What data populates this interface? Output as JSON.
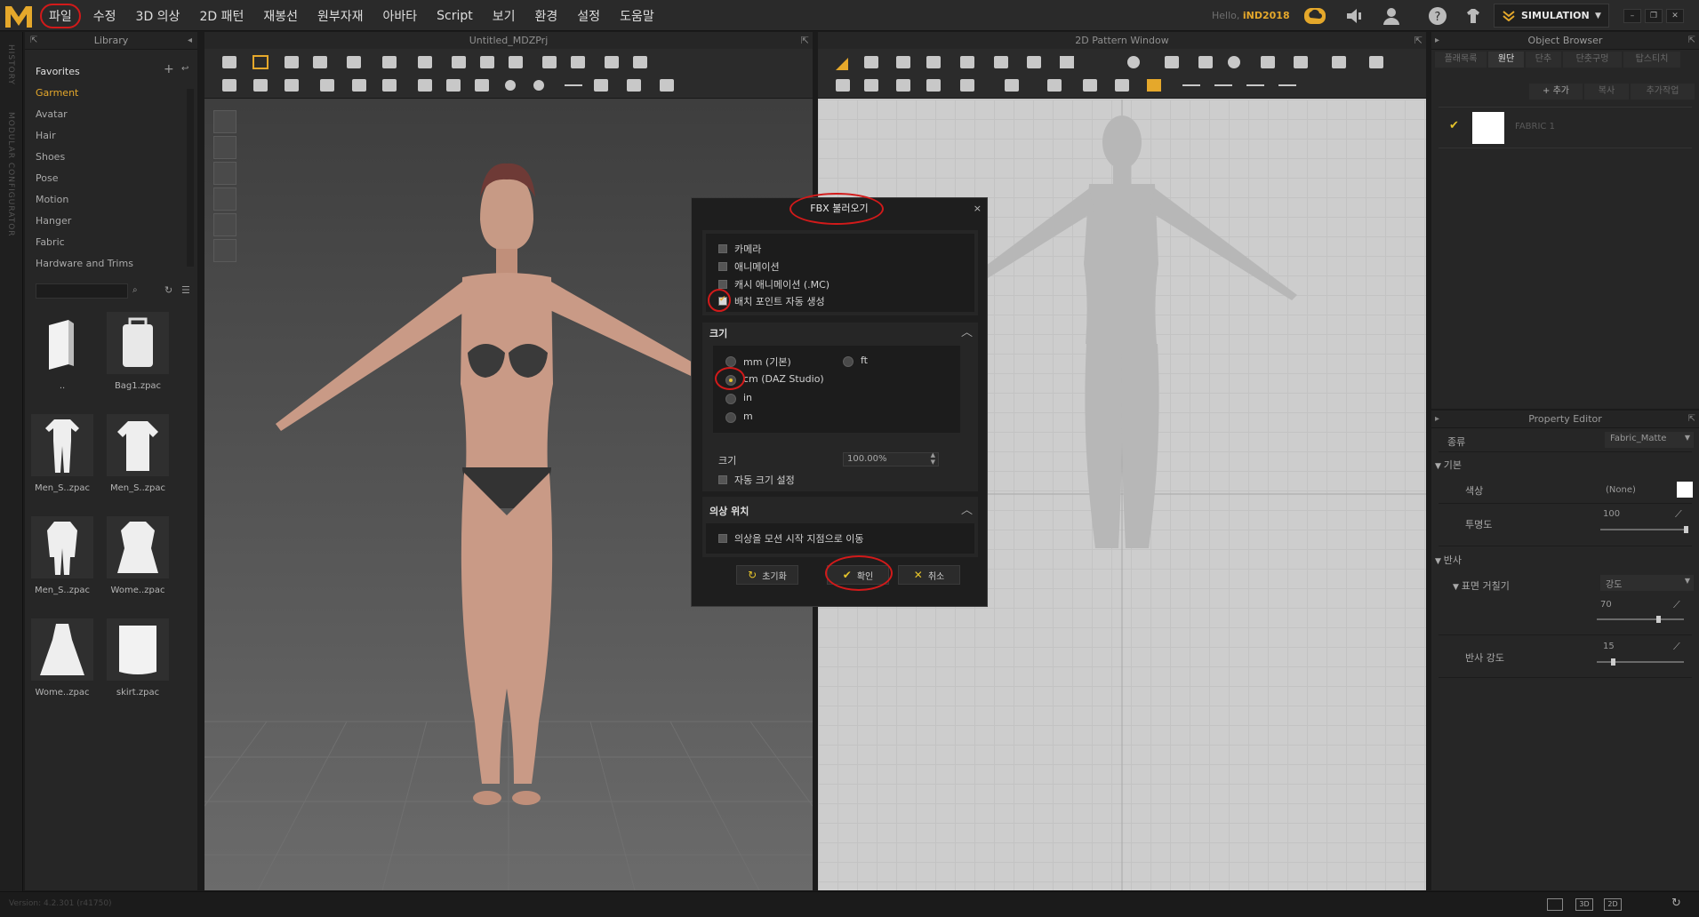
{
  "menu": {
    "items": [
      "파일",
      "수정",
      "3D 의상",
      "2D 패턴",
      "재봉선",
      "원부자재",
      "아바타",
      "Script",
      "보기",
      "환경",
      "설정",
      "도움말"
    ],
    "greeting_prefix": "Hello,",
    "username": "iND2018",
    "simulation_label": "SIMULATION"
  },
  "left_strip": {
    "history": "HISTORY",
    "modular": "MODULAR CONFIGURATOR"
  },
  "library": {
    "title": "Library",
    "tree": [
      "Favorites",
      "Garment",
      "Avatar",
      "Hair",
      "Shoes",
      "Pose",
      "Motion",
      "Hanger",
      "Fabric",
      "Hardware and Trims"
    ],
    "files": [
      "..",
      "Bag1.zpac",
      "Men_S..zpac",
      "Men_S..zpac",
      "Men_S..zpac",
      "Wome..zpac",
      "Wome..zpac",
      "skirt.zpac"
    ]
  },
  "viewport3d": {
    "title": "Untitled_MDZPrj"
  },
  "viewport2d": {
    "title": "2D Pattern Window"
  },
  "object_browser": {
    "title": "Object Browser",
    "tabs": [
      "플래목록",
      "원단",
      "단추",
      "단춧구멍",
      "탑스티치"
    ],
    "add_label": "+ 추가",
    "copy_label": "복사",
    "add_extra_label": "추가작업",
    "fabric_name": "FABRIC 1"
  },
  "property_editor": {
    "title": "Property Editor",
    "type_label": "종류",
    "type_value": "Fabric_Matte",
    "basic_label": "기본",
    "color_label": "색상",
    "color_value": "(None)",
    "opacity_label": "투명도",
    "opacity_value": "100",
    "reflection_label": "반사",
    "roughness_label": "표면 거칠기",
    "roughness_mode": "강도",
    "roughness_value": "70",
    "reflect_strength_label": "반사 강도",
    "reflect_strength_value": "15"
  },
  "status": {
    "version": "Version: 4.2.301 (r41750)"
  },
  "dialog": {
    "title": "FBX 불러오기",
    "close": "×",
    "options": [
      "카메라",
      "애니메이션",
      "캐시 애니메이션 (.MC)",
      "배치 포인트 자동 생성"
    ],
    "size_section": "크기",
    "units": [
      "mm (기본)",
      "ft",
      "cm (DAZ Studio)",
      "in",
      "m"
    ],
    "scale_label": "크기",
    "scale_value": "100.00%",
    "auto_size_label": "자동 크기 설정",
    "position_section": "의상 위치",
    "move_label": "의상을 모션 시작 지점으로 이동",
    "reset_label": "초기화",
    "ok_label": "확인",
    "cancel_label": "취소"
  },
  "colors": {
    "accent": "#e5a82b",
    "annotation": "#d21a1a"
  }
}
